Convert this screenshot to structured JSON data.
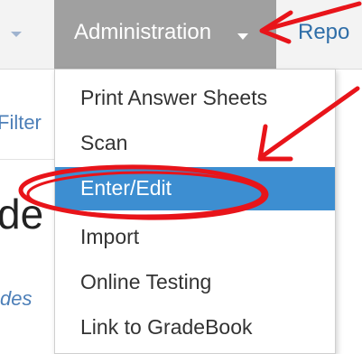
{
  "navbar": {
    "administration_label": "Administration",
    "report_label": "Repo"
  },
  "left_panel": {
    "filter_text": "Filter",
    "heading_text": "de",
    "description_text": "des"
  },
  "menu": {
    "items": [
      {
        "label": "Print Answer Sheets"
      },
      {
        "label": "Scan"
      },
      {
        "label": "Enter/Edit",
        "state": "highlighted"
      },
      {
        "label": "Import"
      },
      {
        "label": "Online Testing"
      },
      {
        "label": "Link to GradeBook"
      }
    ]
  },
  "colors": {
    "active_tab": "#a0a0a0",
    "highlight": "#3d8ed1",
    "annotation": "#e8141a",
    "link": "#2f6ea8"
  }
}
